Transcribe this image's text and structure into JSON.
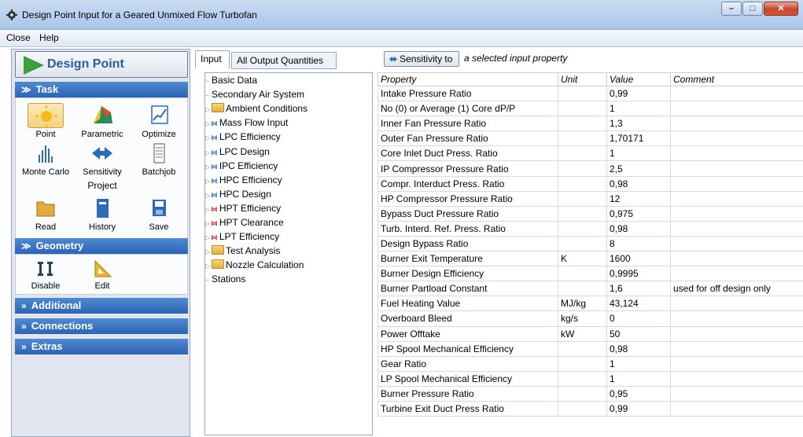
{
  "window": {
    "title": "Design Point Input for a Geared Unmixed Flow Turbofan",
    "icon": "gear-app-icon"
  },
  "menu": {
    "items": [
      "Close",
      "Help"
    ]
  },
  "left": {
    "design_point_label": "Design Point",
    "task": {
      "header": "Task",
      "tools": [
        {
          "label": "Point",
          "icon": "sun-icon"
        },
        {
          "label": "Parametric",
          "icon": "surface-plot-icon"
        },
        {
          "label": "Optimize",
          "icon": "optimize-chart-icon"
        },
        {
          "label": "Monte Carlo",
          "icon": "histogram-icon"
        },
        {
          "label": "Sensitivity",
          "icon": "double-arrow-icon"
        },
        {
          "label": "Batchjob",
          "icon": "document-icon"
        }
      ],
      "project_label": "Project",
      "project_tools": [
        {
          "label": "Read",
          "icon": "folder-icon"
        },
        {
          "label": "History",
          "icon": "notebook-icon"
        },
        {
          "label": "Save",
          "icon": "floppy-icon"
        }
      ]
    },
    "geometry": {
      "header": "Geometry",
      "tools": [
        {
          "label": "Disable",
          "icon": "disable-geometry-icon"
        },
        {
          "label": "Edit",
          "icon": "ruler-triangle-icon"
        }
      ]
    },
    "additional_header": "Additional",
    "connections_header": "Connections",
    "extras_header": "Extras"
  },
  "middle": {
    "tabs": [
      "Input",
      "All Output Quantities"
    ],
    "tree": [
      {
        "label": "Basic Data",
        "icon": "none"
      },
      {
        "label": "Secondary Air System",
        "icon": "none"
      },
      {
        "label": "Ambient Conditions",
        "icon": "folder"
      },
      {
        "label": "Mass Flow Input",
        "icon": "component-blue"
      },
      {
        "label": "LPC Efficiency",
        "icon": "component-blue"
      },
      {
        "label": "LPC Design",
        "icon": "component-blue"
      },
      {
        "label": "IPC Efficiency",
        "icon": "component-blue"
      },
      {
        "label": "HPC Efficiency",
        "icon": "component-blue"
      },
      {
        "label": "HPC Design",
        "icon": "component-blue"
      },
      {
        "label": "HPT Efficiency",
        "icon": "component-red"
      },
      {
        "label": "HPT Clearance",
        "icon": "component-red"
      },
      {
        "label": "LPT Efficiency",
        "icon": "component-red"
      },
      {
        "label": "Test Analysis",
        "icon": "folder"
      },
      {
        "label": "Nozzle Calculation",
        "icon": "folder"
      },
      {
        "label": "Stations",
        "icon": "none"
      }
    ]
  },
  "right": {
    "sensitivity_button": "Sensitivity to",
    "sensitivity_hint": "a selected input property",
    "columns": [
      "Property",
      "Unit",
      "Value",
      "Comment"
    ],
    "rows": [
      [
        "Intake Pressure Ratio",
        "",
        "0,99",
        ""
      ],
      [
        "No (0) or Average (1) Core dP/P",
        "",
        "1",
        ""
      ],
      [
        "Inner Fan Pressure Ratio",
        "",
        "1,3",
        ""
      ],
      [
        "Outer Fan Pressure Ratio",
        "",
        "1,70171",
        ""
      ],
      [
        "Core Inlet Duct Press. Ratio",
        "",
        "1",
        ""
      ],
      [
        "IP Compressor Pressure Ratio",
        "",
        "2,5",
        ""
      ],
      [
        "Compr. Interduct Press. Ratio",
        "",
        "0,98",
        ""
      ],
      [
        "HP Compressor Pressure Ratio",
        "",
        "12",
        ""
      ],
      [
        "Bypass Duct Pressure Ratio",
        "",
        "0,975",
        ""
      ],
      [
        "Turb. Interd. Ref. Press. Ratio",
        "",
        "0,98",
        ""
      ],
      [
        "Design Bypass Ratio",
        "",
        "8",
        ""
      ],
      [
        "Burner Exit Temperature",
        "K",
        "1600",
        ""
      ],
      [
        "Burner Design Efficiency",
        "",
        "0,9995",
        ""
      ],
      [
        "Burner Partload Constant",
        "",
        "1,6",
        "used for off design only"
      ],
      [
        "Fuel Heating Value",
        "MJ/kg",
        "43,124",
        ""
      ],
      [
        "Overboard Bleed",
        "kg/s",
        "0",
        ""
      ],
      [
        "Power Offtake",
        "kW",
        "50",
        ""
      ],
      [
        "HP Spool Mechanical Efficiency",
        "",
        "0,98",
        ""
      ],
      [
        "Gear Ratio",
        "",
        "1",
        ""
      ],
      [
        "LP Spool Mechanical Efficiency",
        "",
        "1",
        ""
      ],
      [
        "Burner Pressure Ratio",
        "",
        "0,95",
        ""
      ],
      [
        "Turbine Exit Duct Press Ratio",
        "",
        "0,99",
        ""
      ]
    ]
  },
  "colors": {
    "section_header": "#2c64b4",
    "play_green": "#3d9e3a",
    "design_point_text": "#2d5aa0"
  }
}
